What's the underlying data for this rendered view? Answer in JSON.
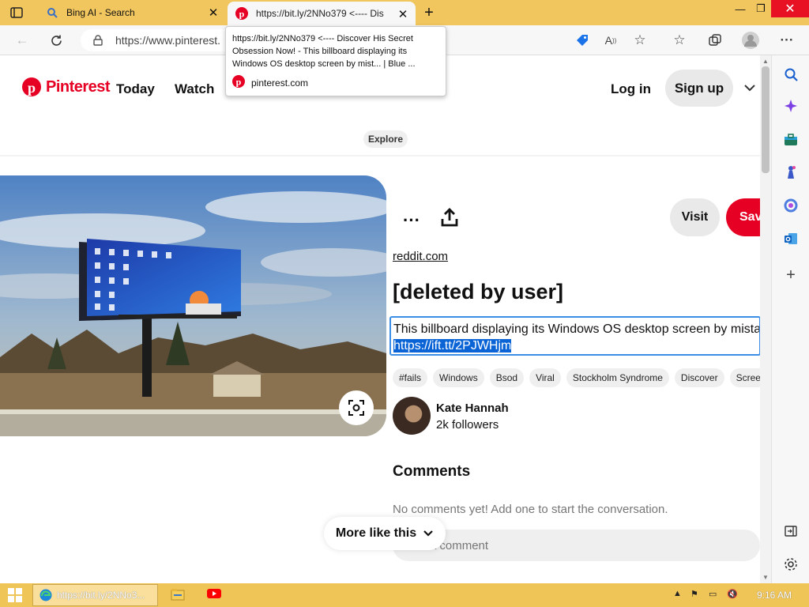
{
  "browser": {
    "tabs": [
      {
        "title": "Bing AI - Search",
        "active": false
      },
      {
        "title": "https://bit.ly/2NNo379 <---- Dis",
        "active": true
      }
    ],
    "address": "https://www.pinterest.",
    "tooltip": {
      "text": "https://bit.ly/2NNo379 <---- Discover His Secret Obsession Now! - This billboard displaying its Windows OS desktop screen by mist... | Blue ...",
      "site": "pinterest.com"
    }
  },
  "header": {
    "logo_text": "Pinterest",
    "nav": [
      "Today",
      "Watch"
    ],
    "login": "Log in",
    "signup": "Sign up"
  },
  "explore_badge": "Explore",
  "pin": {
    "visit": "Visit",
    "save": "Save",
    "source": "reddit.com",
    "title": "[deleted by user]",
    "description": "This billboard displaying its Windows OS desktop screen by mistal",
    "link": "https://ift.tt/2PJWHjm",
    "tags": [
      "#fails",
      "Windows",
      "Bsod",
      "Viral",
      "Stockholm Syndrome",
      "Discover",
      "Screen"
    ],
    "author": {
      "name": "Kate Hannah",
      "followers": "2k followers"
    },
    "comments_heading": "Comments",
    "no_comments": "No comments yet! Add one to start the conversation.",
    "comment_placeholder": "Add a comment",
    "more_like_this": "More like this"
  },
  "taskbar": {
    "edge_task_label": "https://bit.ly/2NNo3...",
    "clock": "9:16 AM"
  },
  "colors": {
    "pinterest_red": "#e60023",
    "tab_strip": "#f1c65e",
    "taskbar": "#f0c558"
  }
}
